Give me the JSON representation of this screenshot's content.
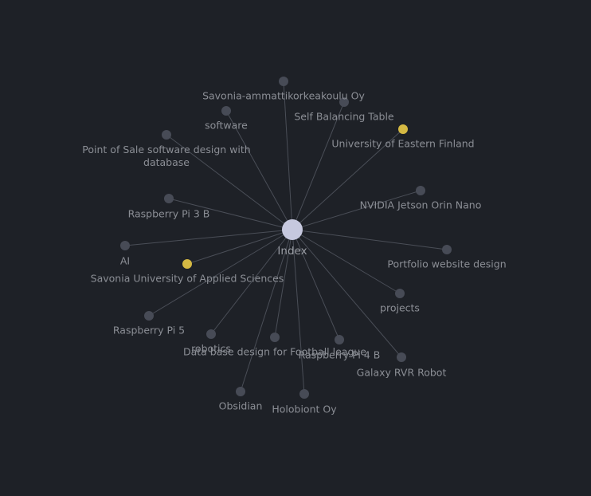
{
  "graph": {
    "colors": {
      "background": "#1e2127",
      "edge": "#4a4e57",
      "node_default": "#474b56",
      "node_highlight": "#d5b943",
      "node_center": "#c6c8de",
      "label": "#8b8e95"
    },
    "center": {
      "id": "index",
      "label": "Index"
    },
    "nodes": [
      {
        "id": "savonia-oy",
        "label": "Savonia-ammattikorkeakoulu Oy",
        "color": "default"
      },
      {
        "id": "self-balancing-table",
        "label": "Self Balancing Table",
        "color": "default"
      },
      {
        "id": "software",
        "label": "software",
        "color": "default"
      },
      {
        "id": "uef",
        "label": "University of Eastern Finland",
        "color": "highlight"
      },
      {
        "id": "pos-design",
        "label": "Point of Sale software design with database",
        "label_lines": [
          "Point of Sale software design with",
          "database"
        ],
        "color": "default"
      },
      {
        "id": "nvidia-jetson",
        "label": "NVIDIA Jetson Orin Nano",
        "color": "default"
      },
      {
        "id": "raspberry-pi-3b",
        "label": "Raspberry Pi 3 B",
        "color": "default"
      },
      {
        "id": "ai",
        "label": "AI",
        "color": "default"
      },
      {
        "id": "portfolio",
        "label": "Portfolio website design",
        "color": "default"
      },
      {
        "id": "savonia-uas",
        "label": "Savonia University of Applied Sciences",
        "color": "highlight"
      },
      {
        "id": "projects",
        "label": "projects",
        "color": "default"
      },
      {
        "id": "raspberry-pi-5",
        "label": "Raspberry Pi 5",
        "color": "default"
      },
      {
        "id": "robotics",
        "label": "robotics",
        "color": "default"
      },
      {
        "id": "football-db",
        "label": "Data base design for Football league",
        "color": "default"
      },
      {
        "id": "raspberry-pi-4b",
        "label": "Raspberry Pi 4 B",
        "color": "default"
      },
      {
        "id": "galaxy-rvr",
        "label": "Galaxy RVR Robot",
        "color": "default"
      },
      {
        "id": "obsidian",
        "label": "Obsidian",
        "color": "default"
      },
      {
        "id": "holobiont",
        "label": "Holobiont Oy",
        "color": "default"
      }
    ]
  }
}
